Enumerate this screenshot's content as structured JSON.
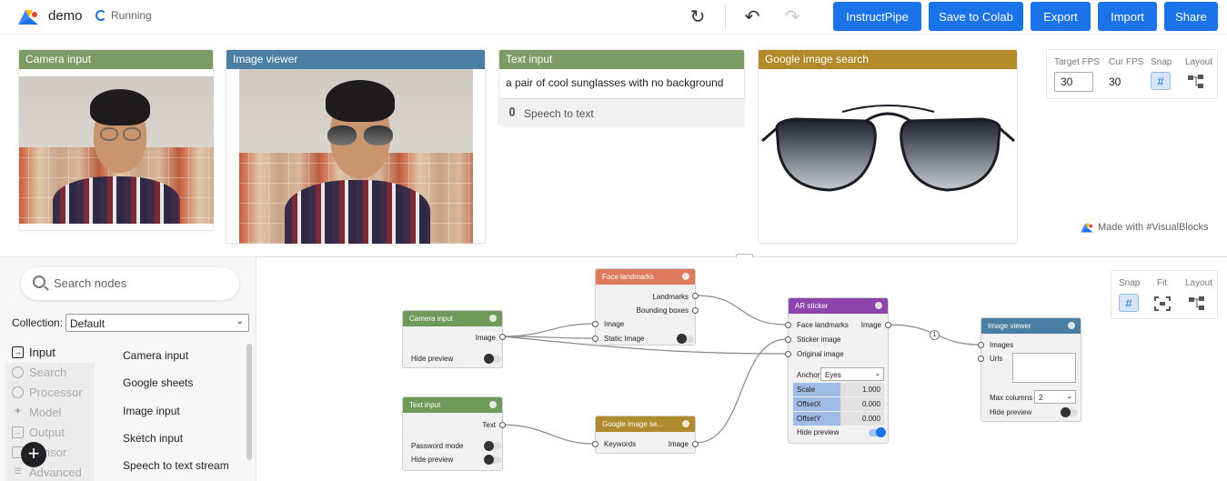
{
  "app": {
    "title": "demo",
    "status": "Running"
  },
  "toolbar": {
    "instructpipe": "InstructPipe",
    "save_colab": "Save to Colab",
    "export": "Export",
    "import": "Import",
    "share": "Share"
  },
  "panels": {
    "camera": {
      "title": "Camera input",
      "color": "#7d9b64"
    },
    "viewer": {
      "title": "Image viewer",
      "color": "#4a7fa3"
    },
    "text": {
      "title": "Text input",
      "color": "#7d9b64",
      "value": "a pair of cool sunglasses with no background",
      "speech": "Speech to text"
    },
    "gsearch": {
      "title": "Google image search",
      "color": "#b38a2a"
    }
  },
  "fps": {
    "target_label": "Target FPS",
    "target_value": "30",
    "cur_label": "Cur FPS",
    "cur_value": "30",
    "snap_label": "Snap",
    "layout_label": "Layout"
  },
  "made_with": "Made with #VisualBlocks",
  "sidebar": {
    "search_placeholder": "Search nodes",
    "collection_label": "Collection:",
    "collection_value": "Default",
    "categories": [
      "Input",
      "Search",
      "Processor",
      "Model",
      "Output",
      "Sensor",
      "Advanced"
    ],
    "items": [
      "Camera input",
      "Google sheets",
      "Image input",
      "Sketch input",
      "Speech to text stream"
    ]
  },
  "canvas_controls": {
    "snap": "Snap",
    "fit": "Fit",
    "layout": "Layout"
  },
  "nodes": {
    "camera": {
      "title": "Camera input",
      "out": "Image",
      "hide": "Hide preview",
      "color": "#6f9a5a"
    },
    "text": {
      "title": "Text input",
      "out": "Text",
      "pw": "Password mode",
      "hide": "Hide preview",
      "color": "#6f9a5a"
    },
    "face": {
      "title": "Face landmarks",
      "out1": "Landmarks",
      "out2": "Bounding boxes",
      "in1": "Image",
      "in2": "Static Image",
      "color": "#e07a5f"
    },
    "gsearch": {
      "title": "Google image se...",
      "in": "Keywords",
      "out": "Image",
      "color": "#b08a2e"
    },
    "ar": {
      "title": "AR sticker",
      "in1": "Face landmarks",
      "in2": "Sticker image",
      "in3": "Original image",
      "out": "Image",
      "anchor_label": "Anchor",
      "anchor_value": "Eyes",
      "scale_label": "Scale",
      "scale_value": "1.000",
      "ox_label": "OffsetX",
      "ox_value": "0.000",
      "oy_label": "OffsetY",
      "oy_value": "0.000",
      "hide": "Hide preview",
      "color": "#8e44ad"
    },
    "viewer": {
      "title": "Image viewer",
      "in1": "Images",
      "in2": "Urls",
      "maxcol_label": "Max columns",
      "maxcol_value": "2",
      "hide": "Hide preview",
      "color": "#4a7fa3"
    },
    "badge": "1"
  }
}
